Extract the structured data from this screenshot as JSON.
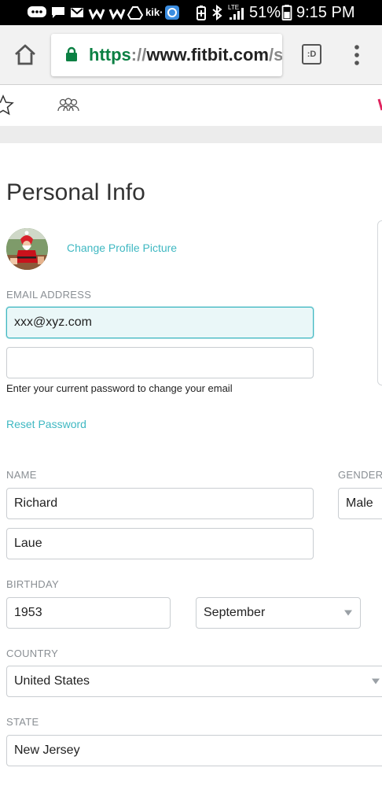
{
  "status_bar": {
    "battery": "51%",
    "time": "9:15 PM",
    "notif_kik": "kik·",
    "notif_lte": "LTE"
  },
  "browser": {
    "url_scheme": "https",
    "url_sep": "://",
    "url_host": "www.fitbit.com",
    "url_rest": "/s",
    "tabs_label": ":D"
  },
  "form": {
    "title": "Personal Info",
    "change_picture": "Change Profile Picture",
    "email_label": "EMAIL ADDRESS",
    "email_value": "xxx@xyz.com",
    "password_value": "",
    "password_hint": "Enter your current password to change your email",
    "reset_password": "Reset Password",
    "name_label": "NAME",
    "first_name": "Richard",
    "last_name": "Laue",
    "gender_label": "GENDER",
    "gender_value": "Male",
    "birthday_label": "BIRTHDAY",
    "birth_year": "1953",
    "birth_month": "September",
    "country_label": "COUNTRY",
    "country_value": "United States",
    "state_label": "STATE",
    "state_value": "New Jersey"
  },
  "colors": {
    "accent": "#3fb8c2",
    "lock_green": "#0b8043"
  }
}
